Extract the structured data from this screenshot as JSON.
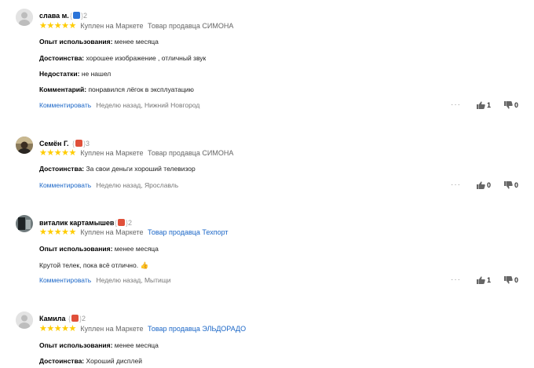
{
  "reviews": [
    {
      "author": "слава м.",
      "achievement_count": "2",
      "badge_color": "#2b74d8",
      "purchase": "Куплен на Маркете",
      "seller": "Товар продавца СИМОНА",
      "seller_is_link": false,
      "fields": [
        {
          "label": "Опыт использования:",
          "value": "менее месяца"
        },
        {
          "label": "Достоинства:",
          "value": "хорошее изображение , отличный звук"
        },
        {
          "label": "Недостатки:",
          "value": "не нашел"
        },
        {
          "label": "Комментарий:",
          "value": "понравился лёгок в эксплуатацию"
        }
      ],
      "comment_link": "Комментировать",
      "meta": "Неделю назад, Нижний Новгород",
      "likes": "1",
      "dislikes": "0"
    },
    {
      "author": "Семён Г.",
      "achievement_count": "3",
      "badge_color": "#e0503a",
      "purchase": "Куплен на Маркете",
      "seller": "Товар продавца СИМОНА",
      "seller_is_link": false,
      "fields": [
        {
          "label": "Достоинства:",
          "value": "За свои деньги хороший телевизор"
        }
      ],
      "comment_link": "Комментировать",
      "meta": "Неделю назад, Ярославль",
      "likes": "0",
      "dislikes": "0"
    },
    {
      "author": "виталик картамышев",
      "achievement_count": "2",
      "badge_color": "#e0503a",
      "purchase": "Куплен на Маркете",
      "seller": "Товар продавца Техпорт",
      "seller_is_link": true,
      "fields": [
        {
          "label": "Опыт использования:",
          "value": "менее месяца"
        },
        {
          "label": "",
          "value": "Крутой телек, пока всё отлично. 👍"
        }
      ],
      "comment_link": "Комментировать",
      "meta": "Неделю назад, Мытищи",
      "likes": "1",
      "dislikes": "0"
    },
    {
      "author": "Камила",
      "achievement_count": "2",
      "badge_color": "#e0503a",
      "purchase": "Куплен на Маркете",
      "seller": "Товар продавца ЭЛЬДОРАДО",
      "seller_is_link": true,
      "fields": [
        {
          "label": "Опыт использования:",
          "value": "менее месяца"
        },
        {
          "label": "Достоинства:",
          "value": "Хороший дисплей"
        }
      ],
      "comment_link": "",
      "meta": "",
      "likes": "",
      "dislikes": ""
    }
  ],
  "stars": "★★★★★",
  "more_dots": "···",
  "colors": {
    "star": "#ffcc00",
    "link": "#1a66c7",
    "meta": "#777777"
  }
}
